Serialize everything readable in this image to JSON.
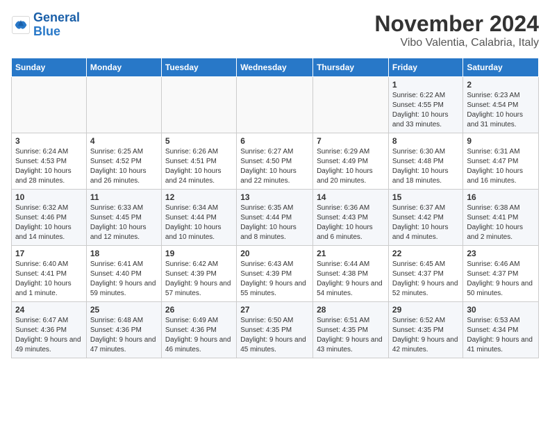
{
  "logo": {
    "line1": "General",
    "line2": "Blue"
  },
  "title": "November 2024",
  "subtitle": "Vibo Valentia, Calabria, Italy",
  "days_of_week": [
    "Sunday",
    "Monday",
    "Tuesday",
    "Wednesday",
    "Thursday",
    "Friday",
    "Saturday"
  ],
  "weeks": [
    [
      {
        "day": "",
        "info": ""
      },
      {
        "day": "",
        "info": ""
      },
      {
        "day": "",
        "info": ""
      },
      {
        "day": "",
        "info": ""
      },
      {
        "day": "",
        "info": ""
      },
      {
        "day": "1",
        "info": "Sunrise: 6:22 AM\nSunset: 4:55 PM\nDaylight: 10 hours and 33 minutes."
      },
      {
        "day": "2",
        "info": "Sunrise: 6:23 AM\nSunset: 4:54 PM\nDaylight: 10 hours and 31 minutes."
      }
    ],
    [
      {
        "day": "3",
        "info": "Sunrise: 6:24 AM\nSunset: 4:53 PM\nDaylight: 10 hours and 28 minutes."
      },
      {
        "day": "4",
        "info": "Sunrise: 6:25 AM\nSunset: 4:52 PM\nDaylight: 10 hours and 26 minutes."
      },
      {
        "day": "5",
        "info": "Sunrise: 6:26 AM\nSunset: 4:51 PM\nDaylight: 10 hours and 24 minutes."
      },
      {
        "day": "6",
        "info": "Sunrise: 6:27 AM\nSunset: 4:50 PM\nDaylight: 10 hours and 22 minutes."
      },
      {
        "day": "7",
        "info": "Sunrise: 6:29 AM\nSunset: 4:49 PM\nDaylight: 10 hours and 20 minutes."
      },
      {
        "day": "8",
        "info": "Sunrise: 6:30 AM\nSunset: 4:48 PM\nDaylight: 10 hours and 18 minutes."
      },
      {
        "day": "9",
        "info": "Sunrise: 6:31 AM\nSunset: 4:47 PM\nDaylight: 10 hours and 16 minutes."
      }
    ],
    [
      {
        "day": "10",
        "info": "Sunrise: 6:32 AM\nSunset: 4:46 PM\nDaylight: 10 hours and 14 minutes."
      },
      {
        "day": "11",
        "info": "Sunrise: 6:33 AM\nSunset: 4:45 PM\nDaylight: 10 hours and 12 minutes."
      },
      {
        "day": "12",
        "info": "Sunrise: 6:34 AM\nSunset: 4:44 PM\nDaylight: 10 hours and 10 minutes."
      },
      {
        "day": "13",
        "info": "Sunrise: 6:35 AM\nSunset: 4:44 PM\nDaylight: 10 hours and 8 minutes."
      },
      {
        "day": "14",
        "info": "Sunrise: 6:36 AM\nSunset: 4:43 PM\nDaylight: 10 hours and 6 minutes."
      },
      {
        "day": "15",
        "info": "Sunrise: 6:37 AM\nSunset: 4:42 PM\nDaylight: 10 hours and 4 minutes."
      },
      {
        "day": "16",
        "info": "Sunrise: 6:38 AM\nSunset: 4:41 PM\nDaylight: 10 hours and 2 minutes."
      }
    ],
    [
      {
        "day": "17",
        "info": "Sunrise: 6:40 AM\nSunset: 4:41 PM\nDaylight: 10 hours and 1 minute."
      },
      {
        "day": "18",
        "info": "Sunrise: 6:41 AM\nSunset: 4:40 PM\nDaylight: 9 hours and 59 minutes."
      },
      {
        "day": "19",
        "info": "Sunrise: 6:42 AM\nSunset: 4:39 PM\nDaylight: 9 hours and 57 minutes."
      },
      {
        "day": "20",
        "info": "Sunrise: 6:43 AM\nSunset: 4:39 PM\nDaylight: 9 hours and 55 minutes."
      },
      {
        "day": "21",
        "info": "Sunrise: 6:44 AM\nSunset: 4:38 PM\nDaylight: 9 hours and 54 minutes."
      },
      {
        "day": "22",
        "info": "Sunrise: 6:45 AM\nSunset: 4:37 PM\nDaylight: 9 hours and 52 minutes."
      },
      {
        "day": "23",
        "info": "Sunrise: 6:46 AM\nSunset: 4:37 PM\nDaylight: 9 hours and 50 minutes."
      }
    ],
    [
      {
        "day": "24",
        "info": "Sunrise: 6:47 AM\nSunset: 4:36 PM\nDaylight: 9 hours and 49 minutes."
      },
      {
        "day": "25",
        "info": "Sunrise: 6:48 AM\nSunset: 4:36 PM\nDaylight: 9 hours and 47 minutes."
      },
      {
        "day": "26",
        "info": "Sunrise: 6:49 AM\nSunset: 4:36 PM\nDaylight: 9 hours and 46 minutes."
      },
      {
        "day": "27",
        "info": "Sunrise: 6:50 AM\nSunset: 4:35 PM\nDaylight: 9 hours and 45 minutes."
      },
      {
        "day": "28",
        "info": "Sunrise: 6:51 AM\nSunset: 4:35 PM\nDaylight: 9 hours and 43 minutes."
      },
      {
        "day": "29",
        "info": "Sunrise: 6:52 AM\nSunset: 4:35 PM\nDaylight: 9 hours and 42 minutes."
      },
      {
        "day": "30",
        "info": "Sunrise: 6:53 AM\nSunset: 4:34 PM\nDaylight: 9 hours and 41 minutes."
      }
    ]
  ]
}
